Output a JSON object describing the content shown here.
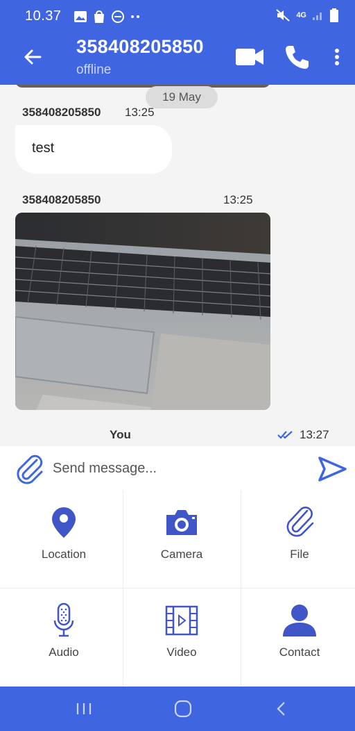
{
  "status_bar": {
    "time": "10.37",
    "network": "4G"
  },
  "header": {
    "title": "358408205850",
    "status": "offline"
  },
  "chat": {
    "date_chip": "19 May",
    "messages": [
      {
        "sender": "358408205850",
        "time": "13:25",
        "text": "test"
      },
      {
        "sender": "358408205850",
        "time": "13:25",
        "type": "image"
      },
      {
        "sender": "You",
        "time": "13:27"
      }
    ]
  },
  "composer": {
    "placeholder": "Send message..."
  },
  "attachments": [
    {
      "label": "Location",
      "icon": "location-pin-icon"
    },
    {
      "label": "Camera",
      "icon": "camera-icon"
    },
    {
      "label": "File",
      "icon": "paperclip-icon"
    },
    {
      "label": "Audio",
      "icon": "microphone-icon"
    },
    {
      "label": "Video",
      "icon": "film-icon"
    },
    {
      "label": "Contact",
      "icon": "person-icon"
    }
  ],
  "colors": {
    "brand": "#3f66e0",
    "chat_bg": "#f4f4f4",
    "icon": "#3f55c8"
  }
}
